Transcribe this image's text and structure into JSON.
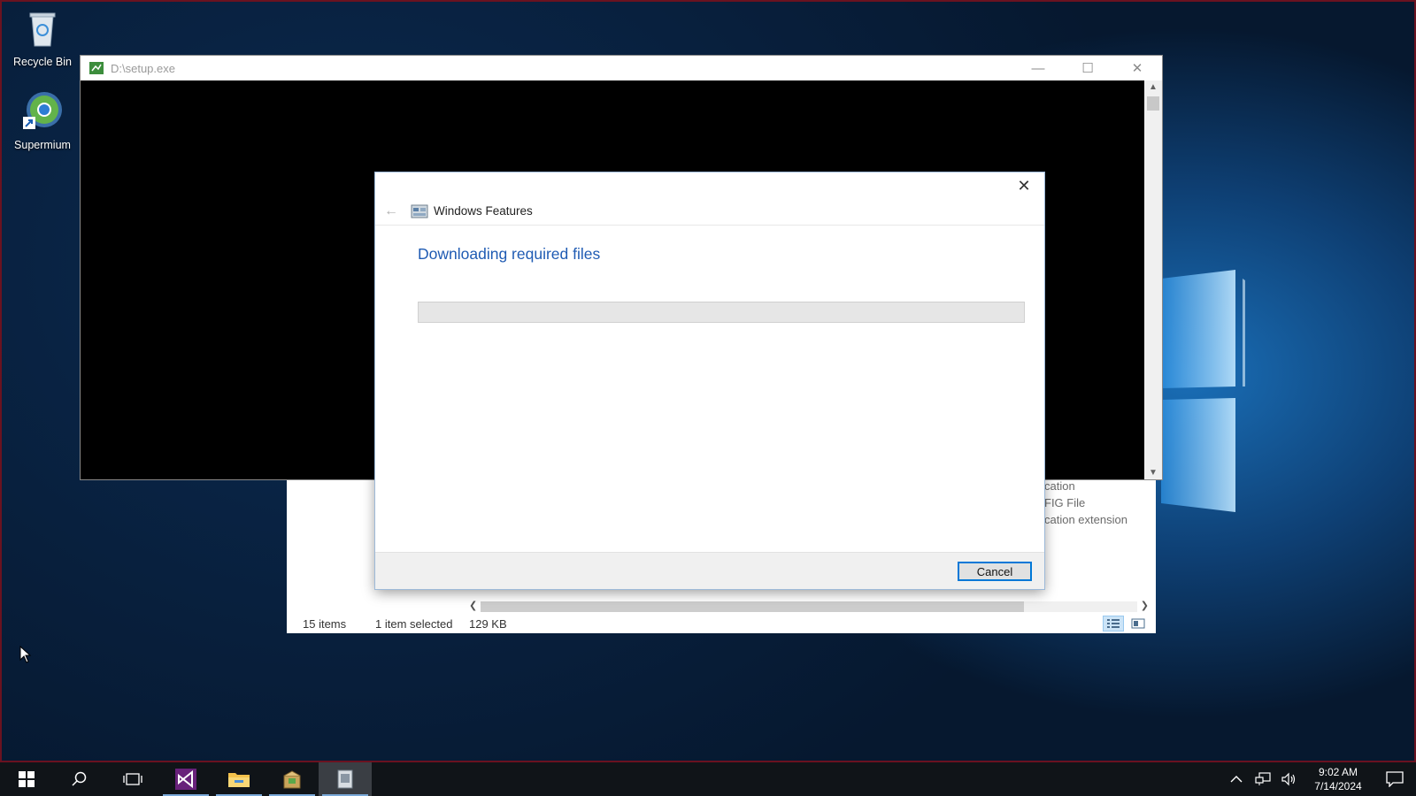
{
  "desktop": {
    "icons": [
      {
        "label": "Recycle Bin",
        "icon": "recycle-bin-icon"
      },
      {
        "label": "Supermium",
        "icon": "supermium-browser-icon"
      }
    ]
  },
  "setup_window": {
    "title": "D:\\setup.exe",
    "controls": {
      "minimize": "—",
      "maximize": "☐",
      "close": "✕"
    }
  },
  "explorer": {
    "type_column": [
      "cation",
      "FIG File",
      "cation extension"
    ],
    "status": {
      "items": "15 items",
      "selected": "1 item selected",
      "size": "129 KB"
    }
  },
  "dialog": {
    "title": "Windows Features",
    "heading": "Downloading required files",
    "progress": 0,
    "close": "✕",
    "back": "←",
    "cancel_label": "Cancel"
  },
  "taskbar": {
    "apps": [
      "windows-start-icon",
      "search-icon",
      "task-view-icon",
      "visual-studio-icon",
      "file-explorer-icon",
      "installer-package-icon",
      "setup-app-icon"
    ],
    "clock": {
      "time": "9:02 AM",
      "date": "7/14/2024"
    }
  },
  "colors": {
    "accent": "#1f5bb3",
    "button_focus": "#0078d7",
    "taskbar": "#101418"
  }
}
